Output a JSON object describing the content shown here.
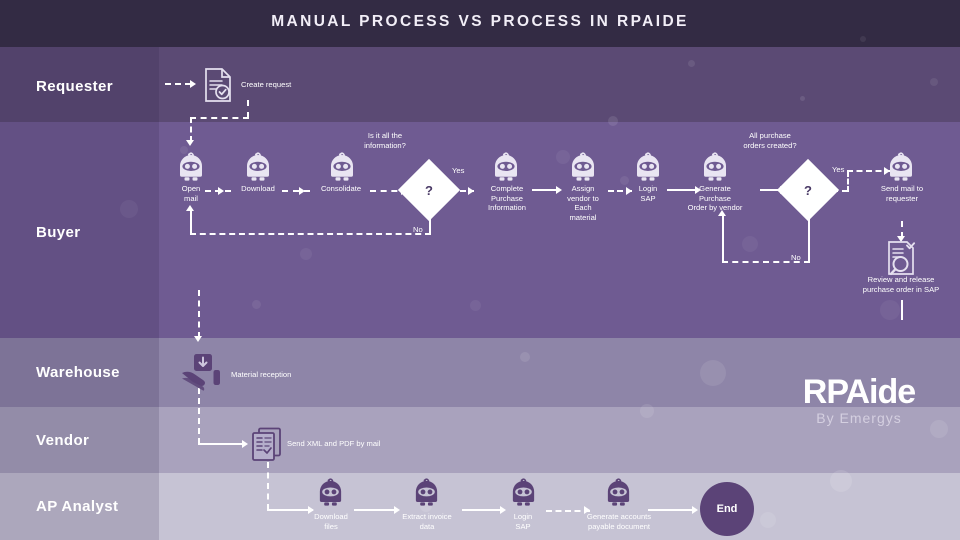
{
  "header": {
    "title": "MANUAL PROCESS VS PROCESS IN RPAIDE"
  },
  "colors": {
    "title_bar": "#332b44",
    "lane_requester": "#5b4a74",
    "lane_buyer": "#6f5b92",
    "lane_warehouse": "#8e85a8",
    "lane_vendor": "#a9a2bd",
    "lane_apanalyst": "#c6c3d4",
    "connector": "#ffffff",
    "decision_fill": "#ffffff",
    "end_node": "#5b4377",
    "icon_light": "#e9e5f2",
    "icon_dark": "#5b4377"
  },
  "lanes": [
    {
      "id": "requester",
      "label": "Requester"
    },
    {
      "id": "buyer",
      "label": "Buyer"
    },
    {
      "id": "warehouse",
      "label": "Warehouse"
    },
    {
      "id": "vendor",
      "label": "Vendor"
    },
    {
      "id": "ap_analyst",
      "label": "AP Analyst"
    }
  ],
  "nodes": {
    "create_request": {
      "label": "Create request",
      "icon": "document-check-icon"
    },
    "open_mail": {
      "label": "Open\nmail",
      "icon": "robot-icon"
    },
    "download": {
      "label": "Download",
      "icon": "robot-icon"
    },
    "consolidate": {
      "label": "Consolidate",
      "icon": "robot-icon"
    },
    "decision_info": {
      "question": "Is it all the\ninformation?",
      "symbol": "?",
      "yes": "Yes",
      "no": "No"
    },
    "complete_purchase_information": {
      "label": "Complete\nPurchase\nInformation",
      "icon": "robot-icon"
    },
    "assign_vendor": {
      "label": "Assign\nvendor to\nEach\nmaterial",
      "icon": "robot-icon"
    },
    "login_sap_buyer": {
      "label": "Login\nSAP",
      "icon": "robot-icon"
    },
    "generate_po": {
      "label": "Generate\nPurchase\nOrder by vendor",
      "icon": "robot-icon"
    },
    "decision_po": {
      "question": "All purchase\norders created?",
      "symbol": "?",
      "yes": "Yes",
      "no": "No"
    },
    "send_mail_to_requester": {
      "label": "Send mail to\nrequester",
      "icon": "robot-icon"
    },
    "review_release_po": {
      "label": "Review and release\npurchase order in SAP",
      "icon": "document-search-icon"
    },
    "material_reception": {
      "label": "Material reception",
      "icon": "hand-package-icon"
    },
    "send_xml_pdf": {
      "label": "Send XML and PDF by mail",
      "icon": "documents-stack-icon"
    },
    "download_files": {
      "label": "Download\nfiles",
      "icon": "robot-icon"
    },
    "extract_invoice_data": {
      "label": "Extract invoice\ndata",
      "icon": "robot-icon"
    },
    "login_sap_ap": {
      "label": "Login\nSAP",
      "icon": "robot-icon"
    },
    "generate_ap_document": {
      "label": "Generate accounts\npayable document",
      "icon": "robot-icon"
    },
    "end": {
      "label": "End"
    }
  },
  "logo": {
    "main": "RPAide",
    "sub": "By Emergys"
  }
}
